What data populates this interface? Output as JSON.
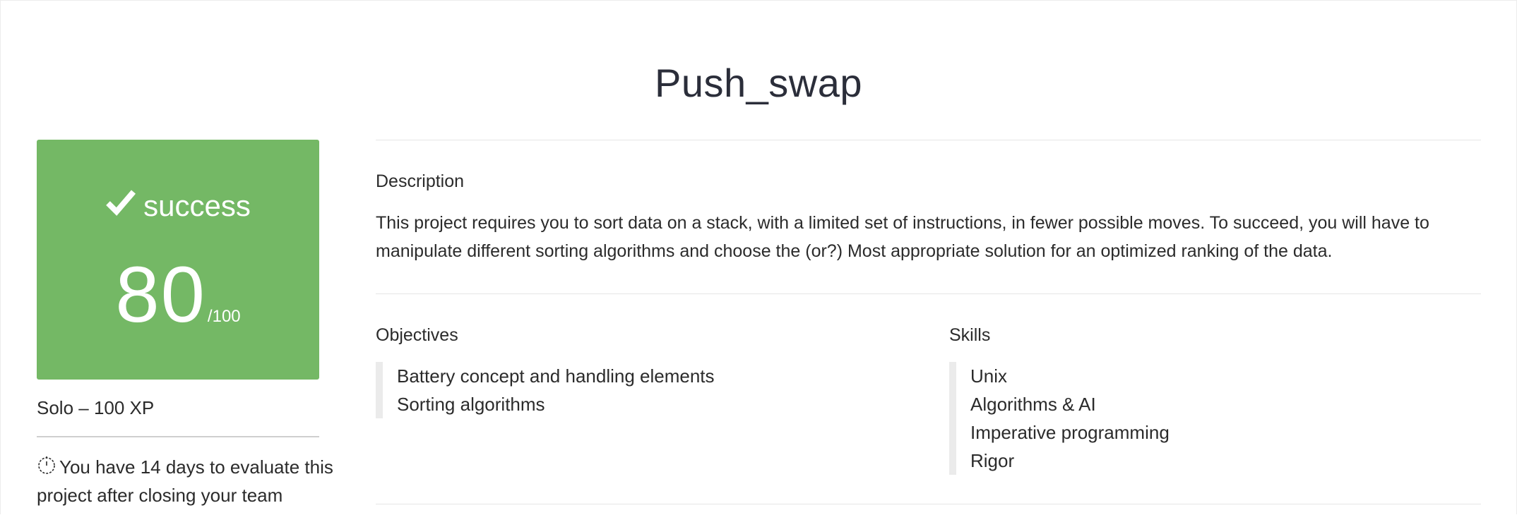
{
  "project": {
    "title": "Push_swap"
  },
  "result": {
    "status": "success",
    "score": "80",
    "score_max": "/100",
    "status_color": "#74b865",
    "icon": "check-icon"
  },
  "meta": {
    "xp_text": "Solo – 100 XP",
    "evaluation_notice": "You have 14 days to evaluate this project after closing your team",
    "notice_icon": "timer-icon"
  },
  "description": {
    "label": "Description",
    "text": "This project requires you to sort data on a stack, with a limited set of instructions, in fewer possible moves. To succeed, you will have to manipulate different sorting algorithms and choose the (or?) Most appropriate solution for an optimized ranking of the data."
  },
  "objectives": {
    "label": "Objectives",
    "items": [
      "Battery concept and handling elements",
      "Sorting algorithms"
    ]
  },
  "skills": {
    "label": "Skills",
    "items": [
      "Unix",
      "Algorithms & AI",
      "Imperative programming",
      "Rigor"
    ]
  }
}
